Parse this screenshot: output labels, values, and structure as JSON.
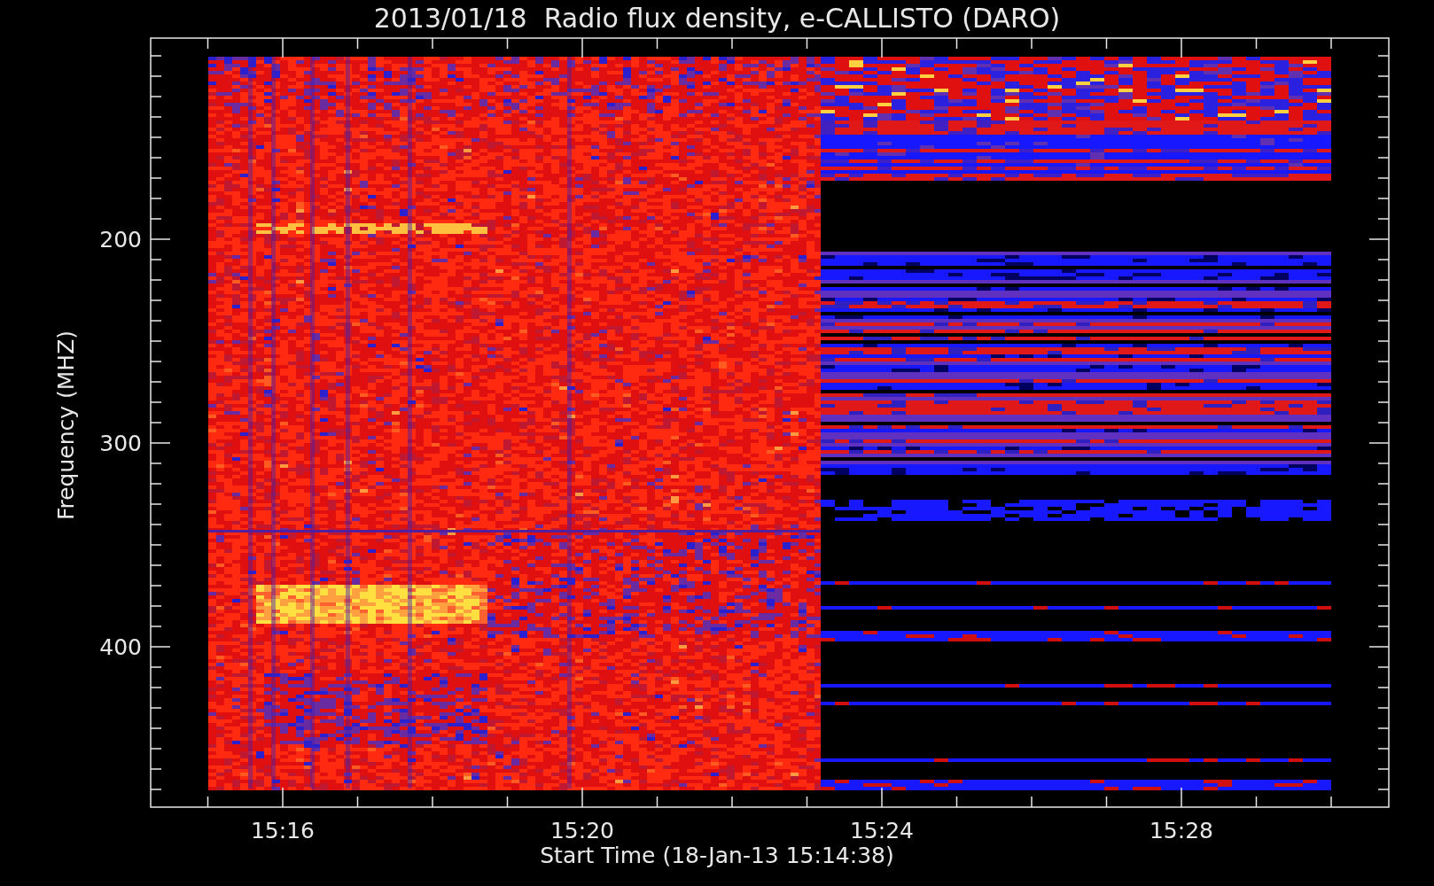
{
  "title": "2013/01/18  Radio flux density, e-CALLISTO (DARO)",
  "y_axis": {
    "label": "Frequency (MHZ)",
    "tick_labels": [
      "200",
      "300",
      "400"
    ]
  },
  "x_axis": {
    "label": "Start Time (18-Jan-13 15:14:38)",
    "tick_labels": [
      "15:16",
      "15:20",
      "15:24",
      "15:28"
    ]
  }
}
